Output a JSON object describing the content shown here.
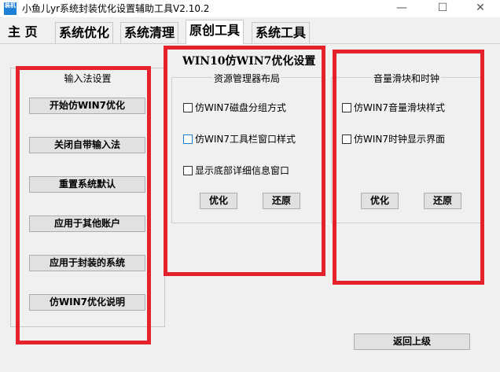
{
  "window": {
    "icon_text": "装机",
    "title": "小鱼儿yr系统封装优化设置辅助工具V2.10.2",
    "minimize_glyph": "—",
    "maximize_glyph": "☐",
    "close_glyph": "✕"
  },
  "tabs": [
    {
      "label": "主 页"
    },
    {
      "label": "系统优化"
    },
    {
      "label": "系统清理"
    },
    {
      "label": "原创工具"
    },
    {
      "label": "系统工具"
    }
  ],
  "heading": "WIN10仿WIN7优化设置",
  "ime_group": {
    "title": "输入法设置",
    "buttons": [
      "开始仿WIN7优化",
      "关闭自带输入法",
      "重置系统默认",
      "应用于其他账户",
      "应用于封装的系统",
      "仿WIN7优化说明"
    ]
  },
  "explorer_group": {
    "title": "资源管理器布局",
    "options": [
      "仿WIN7磁盘分组方式",
      "仿WIN7工具栏窗口样式",
      "显示底部详细信息窗口"
    ],
    "optimize_label": "优化",
    "restore_label": "还原"
  },
  "volume_group": {
    "title": "音量滑块和时钟",
    "options": [
      "仿WIN7音量滑块样式",
      "仿WIN7时钟显示界面"
    ],
    "optimize_label": "优化",
    "restore_label": "还原"
  },
  "back_label": "返回上级",
  "colors": {
    "annotation_red": "#e5222b",
    "focus_blue": "#1e7fd6",
    "panel_bg": "#f0f0f0"
  }
}
